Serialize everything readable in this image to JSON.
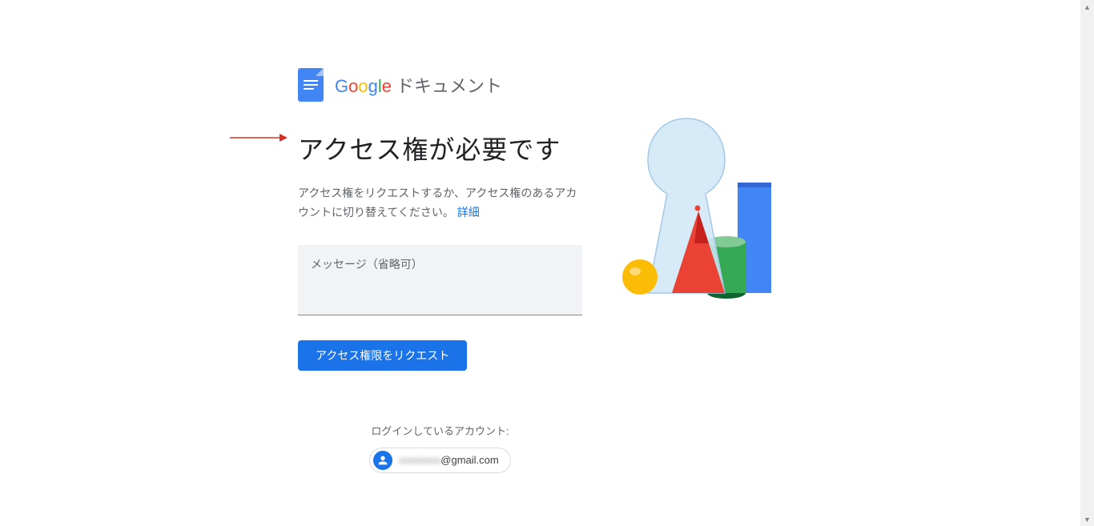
{
  "header": {
    "product_label": "ドキュメント"
  },
  "main": {
    "title": "アクセス権が必要です",
    "description_part1": "アクセス権をリクエストするか、アクセス権のあるアカウントに切り替えてください。",
    "learn_more": "詳細",
    "message_placeholder": "メッセージ（省略可）",
    "request_button": "アクセス権限をリクエスト"
  },
  "account": {
    "label": "ログインしているアカウント:",
    "email_hidden": "xxxxxxxx",
    "email_domain": "@gmail.com"
  }
}
